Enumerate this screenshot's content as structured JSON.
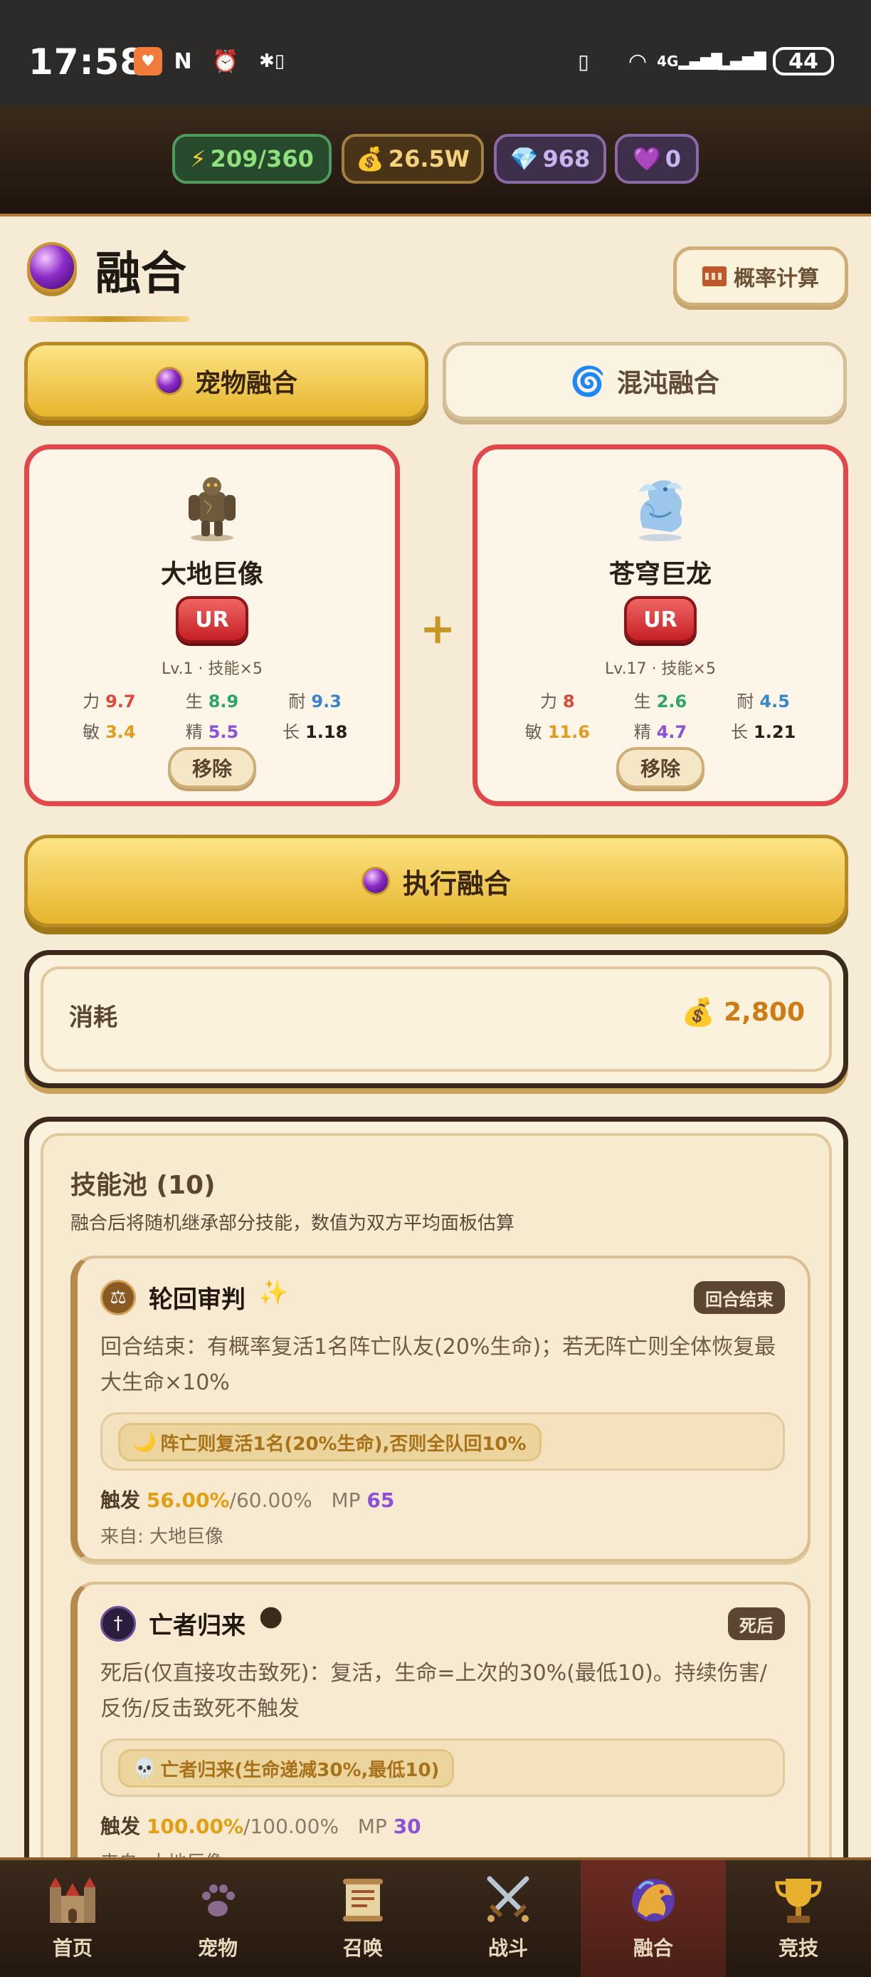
{
  "status_bar": {
    "time": "17:58",
    "network": "4G",
    "battery": "44"
  },
  "resources": {
    "energy": "209/360",
    "gold": "26.5W",
    "diamond": "968",
    "heart": "0"
  },
  "header": {
    "title": "融合",
    "prob_button": "概率计算"
  },
  "tabs": [
    {
      "label": "宠物融合",
      "active": true
    },
    {
      "label": "混沌融合",
      "active": false
    }
  ],
  "pets": [
    {
      "name": "大地巨像",
      "rarity": "UR",
      "lv": "Lv.1 · 技能×5",
      "stats": [
        {
          "k": "力",
          "v": "9.7",
          "c": "#e0493a"
        },
        {
          "k": "生",
          "v": "8.9",
          "c": "#2ca56a"
        },
        {
          "k": "耐",
          "v": "9.3",
          "c": "#3a86c8"
        },
        {
          "k": "敏",
          "v": "3.4",
          "c": "#e39b1c"
        },
        {
          "k": "精",
          "v": "5.5",
          "c": "#8b52d9"
        },
        {
          "k": "长",
          "v": "1.18",
          "c": "#2a1f16"
        }
      ],
      "remove": "移除"
    },
    {
      "name": "苍穹巨龙",
      "rarity": "UR",
      "lv": "Lv.17 · 技能×5",
      "stats": [
        {
          "k": "力",
          "v": "8",
          "c": "#e0493a"
        },
        {
          "k": "生",
          "v": "2.6",
          "c": "#2ca56a"
        },
        {
          "k": "耐",
          "v": "4.5",
          "c": "#3a86c8"
        },
        {
          "k": "敏",
          "v": "11.6",
          "c": "#e39b1c"
        },
        {
          "k": "精",
          "v": "4.7",
          "c": "#8b52d9"
        },
        {
          "k": "长",
          "v": "1.21",
          "c": "#2a1f16"
        }
      ],
      "remove": "移除"
    }
  ],
  "plus": "+",
  "execute_button": "执行融合",
  "cost": {
    "label": "消耗",
    "value": "2,800"
  },
  "skills": {
    "title": "技能池 (10)",
    "desc": "融合后将随机继承部分技能，数值为双方平均面板估算",
    "items": [
      {
        "name": "轮回审判",
        "deco": "✨",
        "tag": "回合结束",
        "text": "回合结束：有概率复活1名阵亡队友(20%生命)；若无阵亡则全体恢复最大生命×10%",
        "effect_icon": "🌙",
        "effect": "阵亡则复活1名(20%生命),否则全队回10%",
        "trigger_label": "触发",
        "trigger_pct": "56.00%",
        "trigger_base": "/60.00%",
        "mp_label": "MP",
        "mp": "65",
        "from": "来自: 大地巨像"
      },
      {
        "name": "亡者归来",
        "deco": "🌑",
        "tag": "死后",
        "text": "死后(仅直接攻击致死)：复活，生命=上次的30%(最低10)。持续伤害/反伤/反击致死不触发",
        "effect_icon": "💀",
        "effect": "亡者归来(生命递减30%,最低10)",
        "trigger_label": "触发",
        "trigger_pct": "100.00%",
        "trigger_base": "/100.00%",
        "mp_label": "MP",
        "mp": "30",
        "from": "来自: 大地巨像"
      }
    ]
  },
  "nav": [
    {
      "label": "首页",
      "icon": "castle-icon"
    },
    {
      "label": "宠物",
      "icon": "paw-icon"
    },
    {
      "label": "召唤",
      "icon": "scroll-icon"
    },
    {
      "label": "战斗",
      "icon": "swords-icon"
    },
    {
      "label": "融合",
      "icon": "dragon-icon",
      "active": true
    },
    {
      "label": "竞技",
      "icon": "trophy-icon"
    }
  ]
}
